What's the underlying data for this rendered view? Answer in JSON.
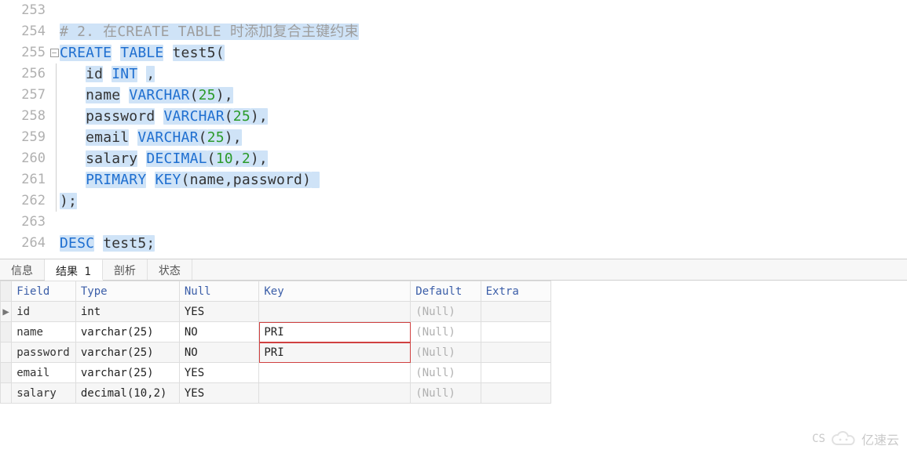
{
  "editor": {
    "lines": [
      {
        "num": "253",
        "fold": "",
        "tokens": []
      },
      {
        "num": "254",
        "fold": "",
        "tokens": [
          {
            "t": "# 2. 在CREATE TABLE 时添加复合主键约束",
            "cls": "cm",
            "hl": true
          }
        ]
      },
      {
        "num": "255",
        "fold": "box",
        "tokens": [
          {
            "t": "CREATE",
            "cls": "kw",
            "hl": true
          },
          {
            "t": " "
          },
          {
            "t": "TABLE",
            "cls": "kw",
            "hl": true
          },
          {
            "t": " "
          },
          {
            "t": "test5(",
            "cls": "txt",
            "hl": true
          }
        ]
      },
      {
        "num": "256",
        "fold": "line",
        "tokens": [
          {
            "t": "   "
          },
          {
            "t": "id",
            "cls": "txt",
            "hl": true
          },
          {
            "t": " "
          },
          {
            "t": "INT",
            "cls": "kw",
            "hl": true
          },
          {
            "t": " "
          },
          {
            "t": ",",
            "cls": "txt",
            "hl": true
          }
        ]
      },
      {
        "num": "257",
        "fold": "line",
        "tokens": [
          {
            "t": "   "
          },
          {
            "t": "name",
            "cls": "txt",
            "hl": true
          },
          {
            "t": " "
          },
          {
            "t": "VARCHAR",
            "cls": "kw",
            "hl": true
          },
          {
            "t": "(",
            "cls": "txt",
            "hl": true
          },
          {
            "t": "25",
            "cls": "num",
            "hl": true
          },
          {
            "t": "),",
            "cls": "txt",
            "hl": true
          }
        ]
      },
      {
        "num": "258",
        "fold": "line",
        "tokens": [
          {
            "t": "   "
          },
          {
            "t": "password",
            "cls": "txt",
            "hl": true
          },
          {
            "t": " "
          },
          {
            "t": "VARCHAR",
            "cls": "kw",
            "hl": true
          },
          {
            "t": "(",
            "cls": "txt",
            "hl": true
          },
          {
            "t": "25",
            "cls": "num",
            "hl": true
          },
          {
            "t": "),",
            "cls": "txt",
            "hl": true
          }
        ]
      },
      {
        "num": "259",
        "fold": "line",
        "tokens": [
          {
            "t": "   "
          },
          {
            "t": "email",
            "cls": "txt",
            "hl": true
          },
          {
            "t": " "
          },
          {
            "t": "VARCHAR",
            "cls": "kw",
            "hl": true
          },
          {
            "t": "(",
            "cls": "txt",
            "hl": true
          },
          {
            "t": "25",
            "cls": "num",
            "hl": true
          },
          {
            "t": "),",
            "cls": "txt",
            "hl": true
          }
        ]
      },
      {
        "num": "260",
        "fold": "line",
        "tokens": [
          {
            "t": "   "
          },
          {
            "t": "salary",
            "cls": "txt",
            "hl": true
          },
          {
            "t": " "
          },
          {
            "t": "DECIMAL",
            "cls": "kw",
            "hl": true
          },
          {
            "t": "(",
            "cls": "txt",
            "hl": true
          },
          {
            "t": "10",
            "cls": "num",
            "hl": true
          },
          {
            "t": ",",
            "cls": "txt",
            "hl": true
          },
          {
            "t": "2",
            "cls": "num",
            "hl": true
          },
          {
            "t": "),",
            "cls": "txt",
            "hl": true
          }
        ]
      },
      {
        "num": "261",
        "fold": "line",
        "tokens": [
          {
            "t": "   "
          },
          {
            "t": "PRIMARY",
            "cls": "kw",
            "hl": true
          },
          {
            "t": " "
          },
          {
            "t": "KEY",
            "cls": "kw",
            "hl": true
          },
          {
            "t": "(name,password)",
            "cls": "txt",
            "hl": true
          },
          {
            "t": " ",
            "cls": "txt",
            "hl": true
          }
        ]
      },
      {
        "num": "262",
        "fold": "end",
        "tokens": [
          {
            "t": ");",
            "cls": "txt",
            "hl": true
          }
        ]
      },
      {
        "num": "263",
        "fold": "",
        "tokens": []
      },
      {
        "num": "264",
        "fold": "",
        "tokens": [
          {
            "t": "DESC",
            "cls": "kw",
            "hl": true
          },
          {
            "t": " "
          },
          {
            "t": "test5;",
            "cls": "txt",
            "hl": true
          }
        ]
      }
    ]
  },
  "tabs": {
    "items": [
      {
        "label": "信息",
        "active": false
      },
      {
        "label": "结果 1",
        "active": true
      },
      {
        "label": "剖析",
        "active": false
      },
      {
        "label": "状态",
        "active": false
      }
    ]
  },
  "table": {
    "headers": [
      "Field",
      "Type",
      "Null",
      "Key",
      "Default",
      "Extra"
    ],
    "rows": [
      {
        "marker": "▶",
        "cells": [
          "id",
          "int",
          "YES",
          "",
          "(Null)",
          ""
        ],
        "pri": false
      },
      {
        "marker": "",
        "cells": [
          "name",
          "varchar(25)",
          "NO",
          "PRI",
          "(Null)",
          ""
        ],
        "pri": true
      },
      {
        "marker": "",
        "cells": [
          "password",
          "varchar(25)",
          "NO",
          "PRI",
          "(Null)",
          ""
        ],
        "pri": true
      },
      {
        "marker": "",
        "cells": [
          "email",
          "varchar(25)",
          "YES",
          "",
          "(Null)",
          ""
        ],
        "pri": false
      },
      {
        "marker": "",
        "cells": [
          "salary",
          "decimal(10,2)",
          "YES",
          "",
          "(Null)",
          ""
        ],
        "pri": false
      }
    ]
  },
  "watermark": {
    "text": "亿速云"
  }
}
